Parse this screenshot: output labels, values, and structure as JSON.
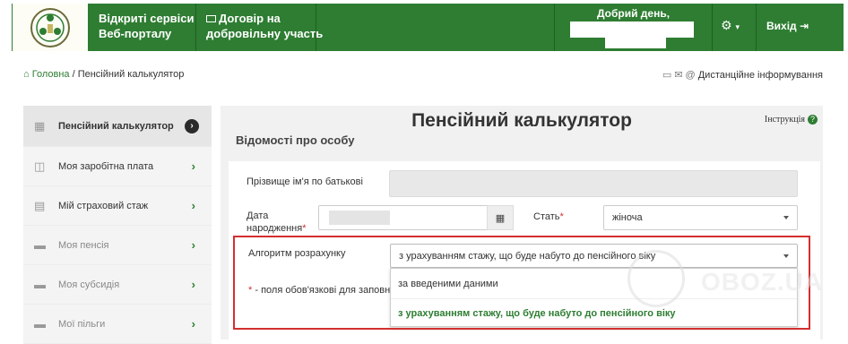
{
  "header": {
    "brand_line1": "Відкриті сервіси",
    "brand_line2": "Веб-порталу",
    "contract_line1": "Договір на",
    "contract_line2": "добровільну участь",
    "greeting": "Добрий день,",
    "exit_label": "Вихід",
    "accent_color": "#2e7d32"
  },
  "breadcrumb": {
    "home": "Головна",
    "separator": "/",
    "current": "Пенсійний калькулятор"
  },
  "remote_info": "Дистанційне інформування",
  "sidebar": {
    "items": [
      {
        "label": "Пенсійний калькулятор",
        "icon": "calculator-icon",
        "active": true
      },
      {
        "label": "Моя заробітна плата",
        "icon": "wallet-icon"
      },
      {
        "label": "Мій страховий стаж",
        "icon": "calendar-icon"
      },
      {
        "label": "Моя пенсія",
        "icon": "folder-icon"
      },
      {
        "label": "Моя субсидія",
        "icon": "folder-icon"
      },
      {
        "label": "Мої пільги",
        "icon": "folder-icon"
      }
    ]
  },
  "main": {
    "title": "Пенсійний калькулятор",
    "instruction": "Інструкція",
    "section_title": "Відомості про особу",
    "form": {
      "fullname_label": "Прізвище ім'я по батькові",
      "birthdate_label_1": "Дата",
      "birthdate_label_2": "народження",
      "sex_label": "Стать",
      "sex_value": "жіноча",
      "algorithm_label": "Алгоритм розрахунку",
      "algorithm_value": "з урахуванням стажу, що буде набуто до пенсійного віку",
      "algorithm_options": [
        "за введеними даними",
        "з урахуванням стажу, що буде набуто до пенсійного віку"
      ],
      "required_note": "- поля обов'язкові для заповне",
      "required_mark": "*"
    }
  },
  "watermark": "OBOZ.UA"
}
